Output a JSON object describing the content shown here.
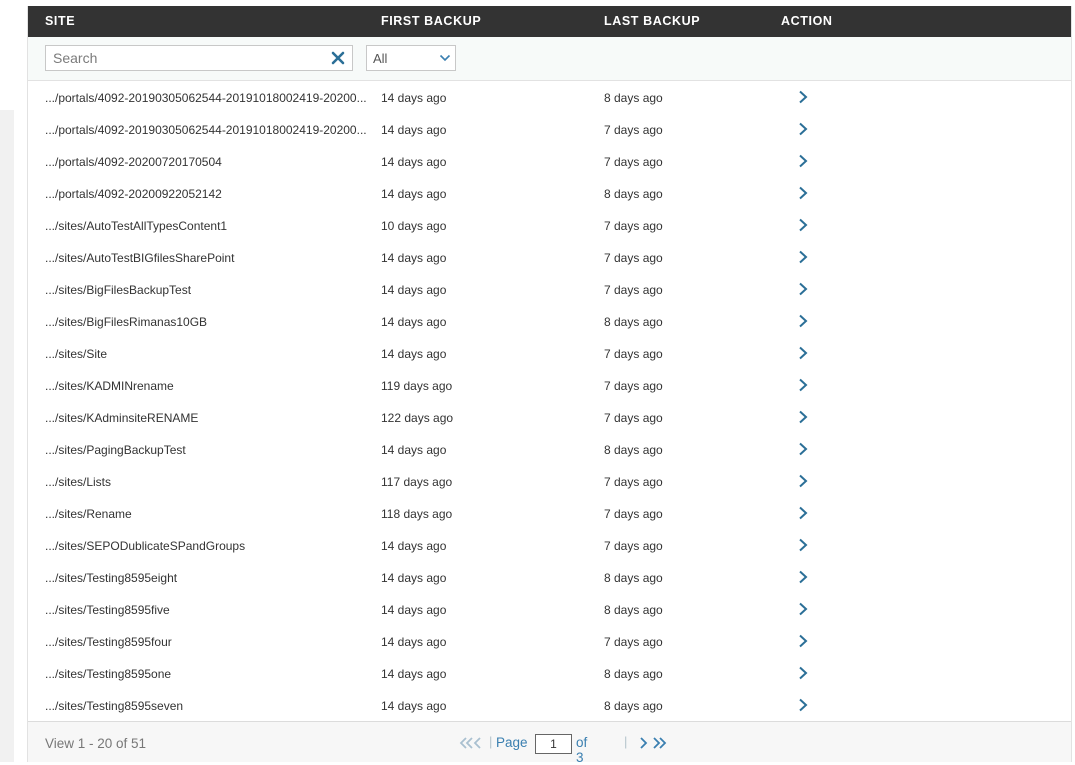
{
  "table": {
    "columns": {
      "site": "SITE",
      "first_backup": "FIRST BACKUP",
      "last_backup": "LAST BACKUP",
      "action": "ACTION"
    },
    "search": {
      "placeholder": "Search",
      "value": ""
    },
    "filter": {
      "selected": "All"
    },
    "rows": [
      {
        "site": ".../portals/4092-20190305062544-20191018002419-20200...",
        "first": "14 days ago",
        "last": "8 days ago"
      },
      {
        "site": ".../portals/4092-20190305062544-20191018002419-20200...",
        "first": "14 days ago",
        "last": "7 days ago"
      },
      {
        "site": ".../portals/4092-20200720170504",
        "first": "14 days ago",
        "last": "7 days ago"
      },
      {
        "site": ".../portals/4092-20200922052142",
        "first": "14 days ago",
        "last": "8 days ago"
      },
      {
        "site": ".../sites/AutoTestAllTypesContent1",
        "first": "10 days ago",
        "last": "7 days ago"
      },
      {
        "site": ".../sites/AutoTestBIGfilesSharePoint",
        "first": "14 days ago",
        "last": "7 days ago"
      },
      {
        "site": ".../sites/BigFilesBackupTest",
        "first": "14 days ago",
        "last": "7 days ago"
      },
      {
        "site": ".../sites/BigFilesRimanas10GB",
        "first": "14 days ago",
        "last": "8 days ago"
      },
      {
        "site": ".../sites/Site",
        "first": "14 days ago",
        "last": "7 days ago"
      },
      {
        "site": ".../sites/KADMINrename",
        "first": "119 days ago",
        "last": "7 days ago"
      },
      {
        "site": ".../sites/KAdminsiteRENAME",
        "first": "122 days ago",
        "last": "7 days ago"
      },
      {
        "site": ".../sites/PagingBackupTest",
        "first": "14 days ago",
        "last": "8 days ago"
      },
      {
        "site": ".../sites/Lists",
        "first": "117 days ago",
        "last": "7 days ago"
      },
      {
        "site": ".../sites/Rename",
        "first": "118 days ago",
        "last": "7 days ago"
      },
      {
        "site": ".../sites/SEPODublicateSPandGroups",
        "first": "14 days ago",
        "last": "7 days ago"
      },
      {
        "site": ".../sites/Testing8595eight",
        "first": "14 days ago",
        "last": "8 days ago"
      },
      {
        "site": ".../sites/Testing8595five",
        "first": "14 days ago",
        "last": "8 days ago"
      },
      {
        "site": ".../sites/Testing8595four",
        "first": "14 days ago",
        "last": "7 days ago"
      },
      {
        "site": ".../sites/Testing8595one",
        "first": "14 days ago",
        "last": "8 days ago"
      },
      {
        "site": ".../sites/Testing8595seven",
        "first": "14 days ago",
        "last": "8 days ago"
      }
    ]
  },
  "footer": {
    "view_info": "View 1 - 20 of 51",
    "page_label": "Page",
    "page_value": "1",
    "of_label": "of 3"
  },
  "colors": {
    "header_bg": "#333333",
    "accent": "#3a7fb0",
    "nav_icon": "#a9c0d0"
  },
  "icons": {
    "clear": "x-clear-icon",
    "dropdown": "chevron-down-icon",
    "row_action": "chevron-right-icon",
    "first": "first-page-icon",
    "prev": "prev-page-icon",
    "next": "next-page-icon",
    "last": "last-page-icon"
  }
}
